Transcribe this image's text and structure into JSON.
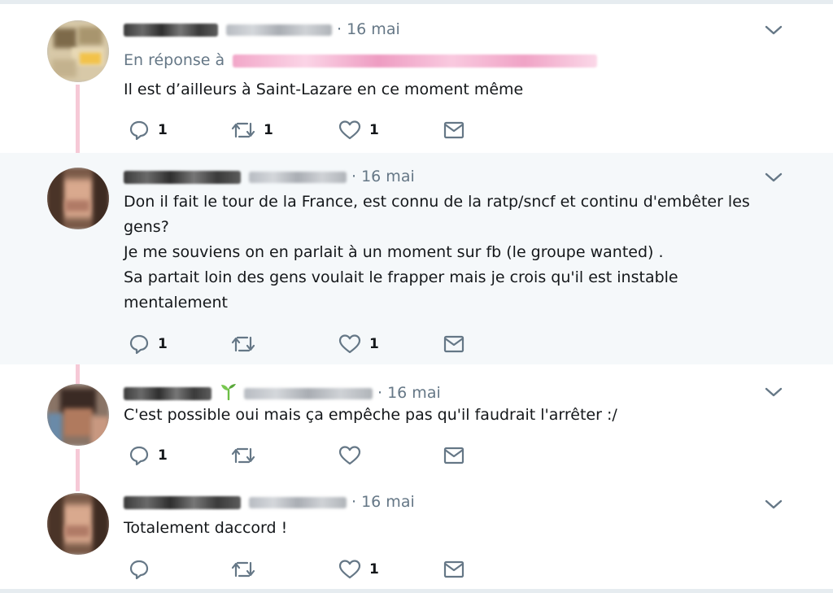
{
  "tweets": [
    {
      "date_sep": "·",
      "date": "16 mai",
      "reply_label": "En réponse à",
      "lines": [
        "Il est d’ailleurs à Saint-Lazare en ce moment même"
      ],
      "replies": "1",
      "retweets": "1",
      "likes": "1"
    },
    {
      "date_sep": "·",
      "date": "16 mai",
      "lines": [
        "Don il fait le tour de la France, est connu de la ratp/sncf et continu d'embêter les",
        "gens?",
        "Je me souviens on en parlait à un moment sur fb (le groupe wanted) .",
        "Sa partait loin des gens voulait le frapper mais je crois qu'il est instable",
        "mentalement"
      ],
      "replies": "1",
      "retweets": "",
      "likes": "1"
    },
    {
      "date_sep": "·",
      "date": "16 mai",
      "lines": [
        "C'est possible oui mais ça empêche pas qu'il faudrait l'arrêter :/"
      ],
      "replies": "1",
      "retweets": "",
      "likes": ""
    },
    {
      "date_sep": "·",
      "date": "16 mai",
      "lines": [
        "Totalement daccord !"
      ],
      "replies": "",
      "retweets": "",
      "likes": "1"
    }
  ],
  "colors": {
    "thread_line": "#f6c9d6",
    "highlight_bg": "#f5f8fa",
    "muted_text": "#657786",
    "body_text": "#14171a"
  },
  "icons": {
    "reply": "reply-icon",
    "retweet": "retweet-icon",
    "like": "heart-icon",
    "dm": "envelope-icon",
    "more": "chevron-down-icon"
  }
}
